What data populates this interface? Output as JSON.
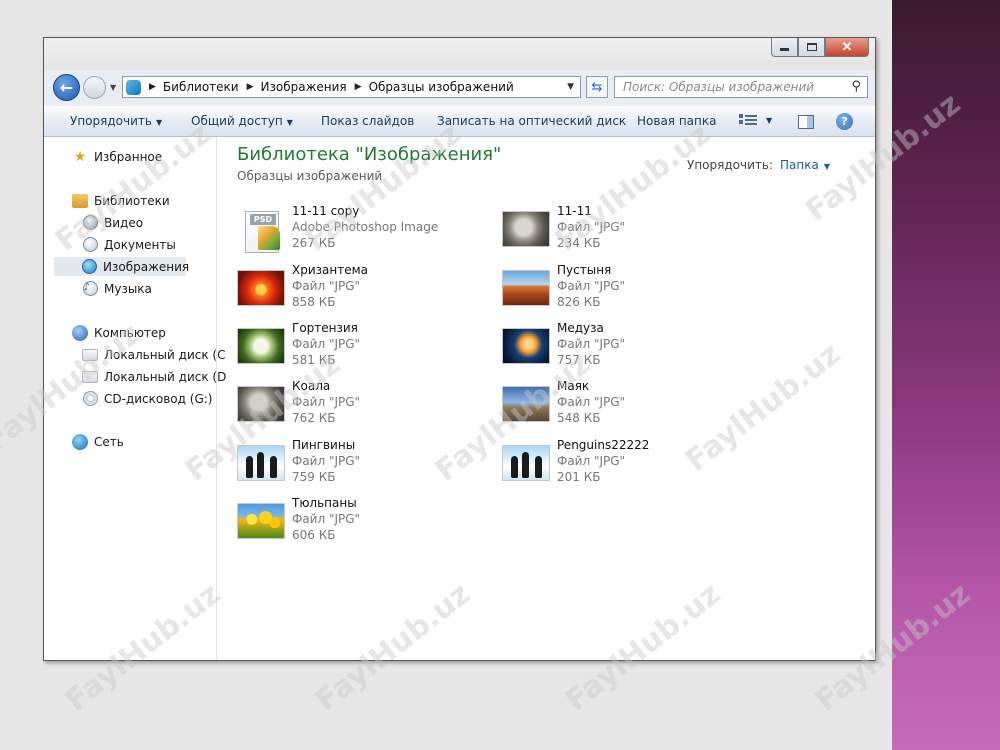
{
  "window": {
    "controls": {
      "minimize": "minimize",
      "maximize": "maximize",
      "close": "✕"
    }
  },
  "address_bar": {
    "crumbs": [
      "Библиотеки",
      "Изображения",
      "Образцы изображений"
    ],
    "search_placeholder": "Поиск: Образцы изображений"
  },
  "toolbar": {
    "organize": "Упорядочить",
    "share": "Общий доступ",
    "slideshow": "Показ слайдов",
    "burn": "Записать на оптический диск",
    "new_folder": "Новая папка",
    "help": "?"
  },
  "navpane": {
    "favorites": "Избранное",
    "libraries": "Библиотеки",
    "video": "Видео",
    "documents": "Документы",
    "pictures": "Изображения",
    "music": "Музыка",
    "computer": "Компьютер",
    "disk_c": "Локальный диск (С",
    "disk_d": "Локальный диск (D",
    "cd": "CD-дисковод (G:)",
    "network": "Сеть"
  },
  "content": {
    "title": "Библиотека \"Изображения\"",
    "subtitle": "Образцы изображений",
    "arrange_label": "Упорядочить:",
    "arrange_value": "Папка"
  },
  "files": [
    {
      "name": "11-11 copy",
      "type": "Adobe Photoshop Image",
      "size": "267 КБ",
      "thumb": "psd"
    },
    {
      "name": "11-11",
      "type": "Файл \"JPG\"",
      "size": "234 КБ",
      "thumb": "koala"
    },
    {
      "name": "Хризантема",
      "type": "Файл \"JPG\"",
      "size": "858 КБ",
      "thumb": "chrysanthemum"
    },
    {
      "name": "Пустыня",
      "type": "Файл \"JPG\"",
      "size": "826 КБ",
      "thumb": "desert"
    },
    {
      "name": "Гортензия",
      "type": "Файл \"JPG\"",
      "size": "581 КБ",
      "thumb": "hydrangea"
    },
    {
      "name": "Медуза",
      "type": "Файл \"JPG\"",
      "size": "757 КБ",
      "thumb": "jellyfish"
    },
    {
      "name": "Коала",
      "type": "Файл \"JPG\"",
      "size": "762 КБ",
      "thumb": "koala"
    },
    {
      "name": "Маяк",
      "type": "Файл \"JPG\"",
      "size": "548 КБ",
      "thumb": "lighthouse"
    },
    {
      "name": "Пингвины",
      "type": "Файл \"JPG\"",
      "size": "759 КБ",
      "thumb": "penguins"
    },
    {
      "name": "Penguins22222",
      "type": "Файл \"JPG\"",
      "size": "201 КБ",
      "thumb": "penguins"
    },
    {
      "name": "Тюльпаны",
      "type": "Файл \"JPG\"",
      "size": "606 КБ",
      "thumb": "tulips"
    }
  ],
  "watermark": "FaylHub.uz",
  "colors": {
    "title_green": "#1d7c31",
    "link_blue": "#1a5ea8",
    "stripe_purple": "#8a3a7e"
  }
}
